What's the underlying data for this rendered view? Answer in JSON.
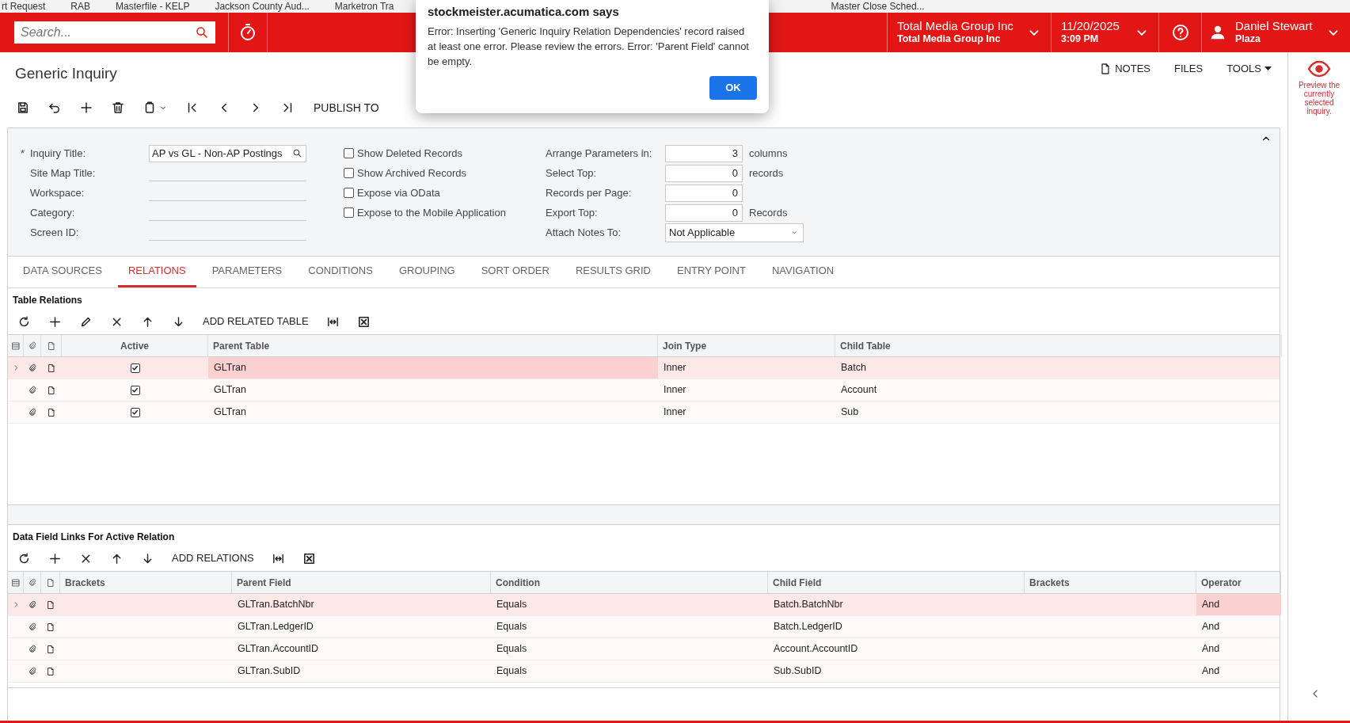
{
  "bookmarks": [
    "rt Request",
    "RAB",
    "Masterfile - KELP",
    "Jackson County Aud...",
    "Marketron Tra",
    "Master Close Sched..."
  ],
  "header": {
    "search_placeholder": "Search...",
    "company": {
      "name": "Total Media Group Inc",
      "branch": "Total Media Group Inc"
    },
    "date": {
      "date": "11/20/2025",
      "time": "3:09 PM"
    },
    "user": {
      "name": "Daniel Stewart",
      "location": "Plaza"
    }
  },
  "dialog": {
    "title": "stockmeister.acumatica.com says",
    "message": "Error: Inserting  'Generic Inquiry Relation Dependencies' record raised at least one error. Please review the errors. Error: 'Parent Field' cannot be empty.",
    "button": "OK"
  },
  "page": {
    "title": "Generic Inquiry",
    "publish_button": "PUBLISH TO",
    "actions": [
      {
        "label": "NOTES",
        "kind": "notes"
      },
      {
        "label": "FILES",
        "kind": "plain"
      },
      {
        "label": "TOOLS",
        "kind": "menu"
      }
    ]
  },
  "preview": "Preview the currently selected inquiry.",
  "form": {
    "required_mark": "*",
    "fields": [
      {
        "label": "Inquiry Title:",
        "value": "AP vs GL - Non-AP Postings",
        "required": true
      },
      {
        "label": "Site Map Title:",
        "required": false
      },
      {
        "label": "Workspace:",
        "required": false
      },
      {
        "label": "Category:",
        "required": false
      },
      {
        "label": "Screen ID:",
        "required": false
      }
    ],
    "options": [
      {
        "label": "Show Deleted Records",
        "checked": false
      },
      {
        "label": "Show Archived Records",
        "checked": false
      },
      {
        "label": "Expose via OData",
        "checked": false
      },
      {
        "label": "Expose to the Mobile Application",
        "checked": false
      }
    ],
    "parameters": [
      {
        "label": "Arrange Parameters in:",
        "value": "3",
        "suffix": "columns",
        "kind": "number"
      },
      {
        "label": "Select Top:",
        "value": "0",
        "suffix": "records",
        "kind": "number"
      },
      {
        "label": "Records per Page:",
        "value": "0",
        "kind": "number"
      },
      {
        "label": "Export Top:",
        "value": "0",
        "suffix": "Records",
        "kind": "number"
      },
      {
        "label": "Attach Notes To:",
        "value": "Not Applicable",
        "kind": "select"
      }
    ]
  },
  "tabs": [
    {
      "label": "DATA SOURCES",
      "selected": false
    },
    {
      "label": "RELATIONS",
      "selected": true
    },
    {
      "label": "PARAMETERS",
      "selected": false
    },
    {
      "label": "CONDITIONS",
      "selected": false
    },
    {
      "label": "GROUPING",
      "selected": false
    },
    {
      "label": "SORT ORDER",
      "selected": false
    },
    {
      "label": "RESULTS GRID",
      "selected": false
    },
    {
      "label": "ENTRY POINT",
      "selected": false
    },
    {
      "label": "NAVIGATION",
      "selected": false
    }
  ],
  "table_relations": {
    "title": "Table Relations",
    "add_button": "ADD RELATED TABLE",
    "columns": [
      "Active",
      "Parent Table",
      "Join Type",
      "Child Table"
    ],
    "rows": [
      {
        "selected": true,
        "cells": [
          {
            "kind": "checkbox",
            "checked": true,
            "focused": false
          },
          {
            "text": "GLTran",
            "focused": true
          },
          {
            "text": "Inner",
            "focused": false
          },
          {
            "text": "Batch",
            "focused": false
          }
        ]
      },
      {
        "selected": false,
        "cells": [
          {
            "kind": "checkbox",
            "checked": true,
            "focused": false
          },
          {
            "text": "GLTran",
            "focused": false
          },
          {
            "text": "Inner",
            "focused": false
          },
          {
            "text": "Account",
            "focused": false
          }
        ]
      },
      {
        "selected": false,
        "cells": [
          {
            "kind": "checkbox",
            "checked": true,
            "focused": false
          },
          {
            "text": "GLTran",
            "focused": false
          },
          {
            "text": "Inner",
            "focused": false
          },
          {
            "text": "Sub",
            "focused": false
          }
        ]
      }
    ]
  },
  "data_field_links": {
    "title": "Data Field Links For Active Relation",
    "add_button": "ADD RELATIONS",
    "columns": [
      "Brackets",
      "Parent Field",
      "Condition",
      "Child Field",
      "Brackets",
      "Operator"
    ],
    "rows": [
      {
        "selected": true,
        "cells": [
          {
            "focused": false
          },
          {
            "text": "GLTran.BatchNbr",
            "focused": false
          },
          {
            "text": "Equals",
            "focused": false
          },
          {
            "text": "Batch.BatchNbr",
            "focused": false
          },
          {
            "focused": false
          },
          {
            "text": "And",
            "focused": true
          }
        ]
      },
      {
        "selected": false,
        "cells": [
          {
            "focused": false
          },
          {
            "text": "GLTran.LedgerID",
            "focused": false
          },
          {
            "text": "Equals",
            "focused": false
          },
          {
            "text": "Batch.LedgerID",
            "focused": false
          },
          {
            "focused": false
          },
          {
            "text": "And",
            "focused": false
          }
        ]
      },
      {
        "selected": false,
        "cells": [
          {
            "focused": false
          },
          {
            "text": "GLTran.AccountID",
            "focused": false
          },
          {
            "text": "Equals",
            "focused": false
          },
          {
            "text": "Account.AccountID",
            "focused": false
          },
          {
            "focused": false
          },
          {
            "text": "And",
            "focused": false
          }
        ]
      },
      {
        "selected": false,
        "cells": [
          {
            "focused": false
          },
          {
            "text": "GLTran.SubID",
            "focused": false
          },
          {
            "text": "Equals",
            "focused": false
          },
          {
            "text": "Sub.SubID",
            "focused": false
          },
          {
            "focused": false
          },
          {
            "text": "And",
            "focused": false
          }
        ]
      }
    ]
  }
}
